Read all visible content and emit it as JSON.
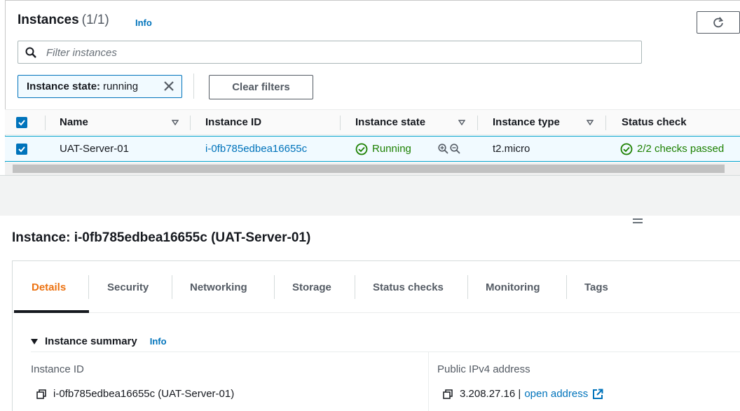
{
  "instances_panel": {
    "title": "Instances",
    "count": "(1/1)",
    "info": "Info",
    "search_placeholder": "Filter instances",
    "filter_token_key": "Instance state:",
    "filter_token_value": "running",
    "clear_filters": "Clear filters"
  },
  "table": {
    "columns": [
      "Name",
      "Instance ID",
      "Instance state",
      "Instance type",
      "Status check"
    ],
    "rows": [
      {
        "name": "UAT-Server-01",
        "instance_id": "i-0fb785edbea16655c",
        "state": "Running",
        "type": "t2.micro",
        "status_check": "2/2 checks passed"
      }
    ]
  },
  "details": {
    "title": "Instance: i-0fb785edbea16655c (UAT-Server-01)",
    "tabs": [
      "Details",
      "Security",
      "Networking",
      "Storage",
      "Status checks",
      "Monitoring",
      "Tags"
    ],
    "active_tab": "Details",
    "summary_title": "Instance summary",
    "summary_info": "Info",
    "instance_id_label": "Instance ID",
    "instance_id_value": "i-0fb785edbea16655c (UAT-Server-01)",
    "public_ip_label": "Public IPv4 address",
    "public_ip_value": "3.208.27.16 |",
    "open_address": "open address"
  },
  "colors": {
    "link": "#0073bb",
    "success": "#1d8102",
    "active_tab": "#ec7211",
    "selected_row_bg": "#f1faff"
  }
}
